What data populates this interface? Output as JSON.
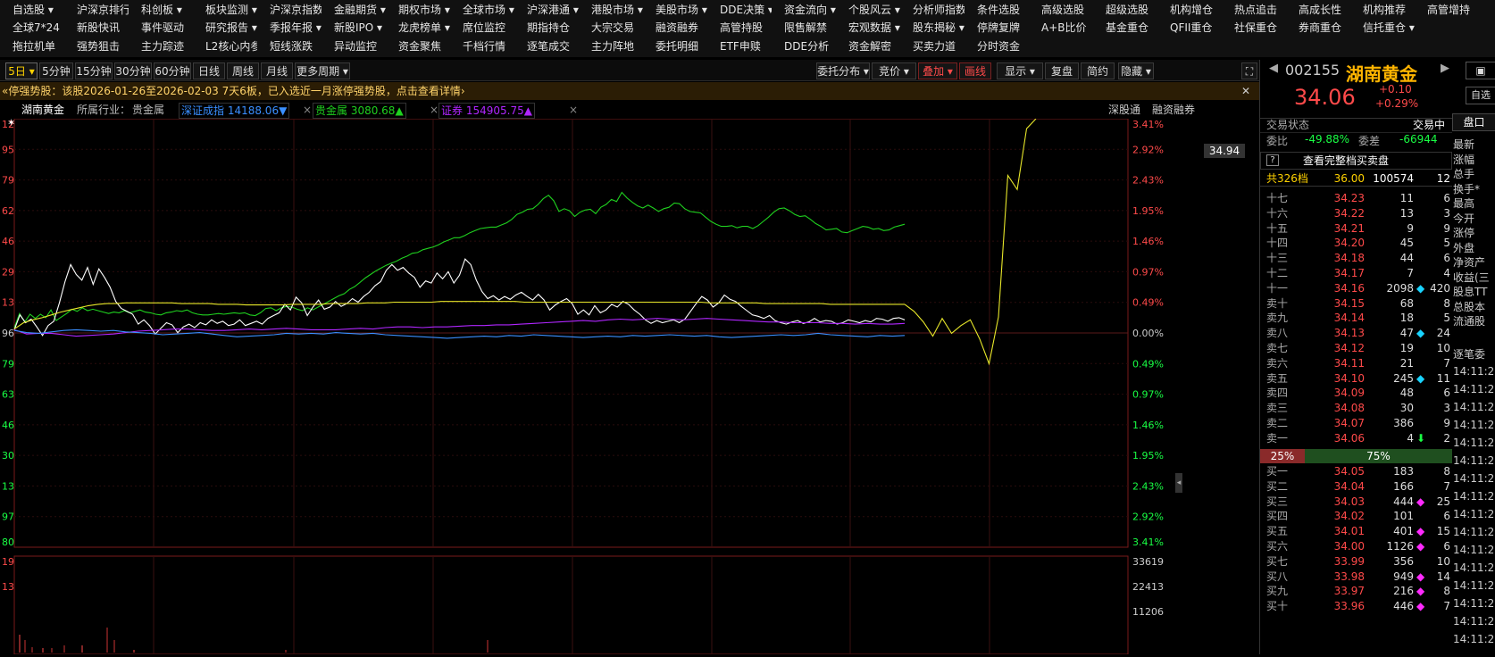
{
  "menu_row1": [
    "自选股 ▾",
    "沪深京排行 ▾",
    "科创板 ▾",
    "板块监测 ▾",
    "沪深京指数 ▾",
    "金融期货 ▾",
    "期权市场 ▾",
    "全球市场 ▾",
    "沪深港通 ▾",
    "港股市场 ▾",
    "美股市场 ▾",
    "DDE决策 ▾",
    "资金流向 ▾",
    "个股风云 ▾",
    "分析师指数",
    "条件选股",
    "高级选股",
    "超级选股",
    "机构增仓",
    "热点追击",
    "高成长性",
    "机构推荐",
    "高管增持"
  ],
  "menu_row2": [
    "全球7*24",
    "新股快讯",
    "事件驱动",
    "研究报告 ▾",
    "季报年报 ▾",
    "新股IPO ▾",
    "龙虎榜单 ▾",
    "席位监控",
    "期指持仓",
    "大宗交易",
    "融资融券",
    "高管持股",
    "限售解禁",
    "宏观数据 ▾",
    "股东揭秘 ▾",
    "停牌复牌",
    "A+B比价",
    "基金重仓",
    "QFII重仓",
    "社保重仓",
    "券商重仓",
    "信托重仓 ▾"
  ],
  "menu_row3": [
    "拖拉机单",
    "强势狙击",
    "主力踪迹",
    "L2核心内参",
    "短线涨跌",
    "异动监控",
    "资金聚焦",
    "千档行情",
    "逐笔成交",
    "主力阵地",
    "委托明细",
    "ETF申赎",
    "DDE分析",
    "资金解密",
    "买卖力道",
    "分时资金"
  ],
  "periods": [
    "5日 ▾",
    "5分钟",
    "15分钟",
    "30分钟",
    "60分钟",
    "日线",
    "周线",
    "月线",
    "更多周期 ▾"
  ],
  "tools": [
    "委托分布 ▾",
    "竞价 ▾",
    "叠加 ▾",
    "画线",
    "显示 ▾",
    "复盘",
    "简约",
    "隐藏 ▾"
  ],
  "notice": "«停强势股：该股2026-01-26至2026-02-03 7天6板，已入选近一月涨停强势股，点击查看详情›",
  "legend": {
    "stock": "湖南黄金",
    "industry_label": "所属行业：",
    "industry": "贵金属",
    "index1": "深证成指 14188.06▼",
    "index2": "贵金属 3080.68▲",
    "index3": "证券 154905.75▲",
    "link1": "深股通",
    "link2": "融资融券"
  },
  "price_tag": "34.94",
  "y_left": [
    "12",
    "95",
    "79",
    "62",
    "46",
    "29",
    "13",
    "96",
    "79",
    "63",
    "46",
    "30",
    "13",
    "97",
    "80"
  ],
  "y_right": [
    "3.41%",
    "2.92%",
    "2.43%",
    "1.95%",
    "1.46%",
    "0.97%",
    "0.49%",
    "0.00%",
    "0.49%",
    "0.97%",
    "1.46%",
    "1.95%",
    "2.43%",
    "2.92%",
    "3.41%"
  ],
  "vol_left": [
    "19",
    "13"
  ],
  "vol_right": [
    "33619",
    "22413",
    "11206"
  ],
  "colors": {
    "up": "#ff4a4a",
    "down": "#19d3ff",
    "green": "#1fd11f",
    "yellow": "#e8e82a",
    "white": "#ffffff",
    "purple": "#b026ff",
    "blue": "#3a8fff"
  },
  "chart_data": {
    "type": "line",
    "series": [
      {
        "name": "贵金属",
        "color": "#1fd11f",
        "values": [
          0.5,
          2.5,
          1.3,
          2.4,
          1.8,
          2.4,
          1.9,
          3.0,
          1.5,
          2.0,
          2.5,
          3.1,
          2.8,
          3.3,
          2.9,
          3.1,
          2.9,
          2.7,
          2.5,
          2.7,
          2.6,
          2.9,
          2.6,
          2.8,
          3.0,
          2.7,
          2.6,
          2.4,
          2.3,
          2.6,
          2.7,
          2.9,
          2.8,
          3.0,
          2.6,
          2.4,
          2.3,
          2.3,
          2.4,
          2.5,
          2.4,
          2.5,
          2.6,
          2.5,
          2.6,
          2.3,
          2.2,
          2.6,
          3.2,
          3.3,
          2.9,
          3.3,
          3.5,
          3.4,
          3.1,
          2.9,
          3.3,
          3.0,
          3.4,
          3.8,
          4.2,
          4.6,
          5.0,
          5.3,
          5.9,
          6.3,
          6.9,
          7.5,
          8.0,
          8.5,
          8.9,
          9.3,
          9.6,
          9.9,
          10.3,
          10.6,
          11.0,
          11.1,
          11.5,
          11.7,
          11.9,
          12.2,
          12.6,
          12.9,
          13.2,
          13.2,
          13.5,
          13.9,
          14.2,
          14.5,
          14.6,
          14.7,
          14.7,
          15.0,
          15.3,
          15.8,
          16.5,
          16.8,
          17.2,
          17.3,
          17.9,
          18.7,
          19.2,
          18.4,
          16.9,
          17.3,
          17.0,
          16.2,
          16.8,
          17.1,
          17.2,
          16.6,
          17.5,
          17.9,
          18.6,
          18.3,
          19.6,
          18.8,
          18.2,
          17.7,
          17.4,
          17.8,
          17.4,
          16.9,
          17.3,
          17.5,
          18.1,
          18.0,
          17.3,
          16.9,
          16.8,
          16.7,
          16.1,
          15.5,
          15.1,
          14.8,
          14.8,
          14.9,
          14.6,
          14.8,
          14.8,
          14.5,
          14.9,
          15.5,
          16.1,
          16.8,
          17.3,
          17.4,
          17.0,
          16.5,
          16.2,
          16.3,
          15.8,
          15.2,
          14.8,
          14.3,
          14.4,
          14.5,
          14.0,
          13.9,
          14.2,
          14.5,
          14.8,
          14.7,
          14.4,
          14.5,
          14.2,
          14.3,
          14.7,
          14.9,
          15.1
        ]
      },
      {
        "name": "湖南黄金",
        "color": "#ffffff",
        "values": [
          0.2,
          2.3,
          1.2,
          1.7,
          0.6,
          -0.6,
          0.8,
          1.4,
          4.0,
          7.0,
          9.4,
          8.0,
          7.2,
          9.0,
          6.6,
          8.8,
          7.6,
          6.2,
          4.2,
          3.2,
          2.8,
          2.4,
          1.0,
          1.6,
          0.8,
          -0.4,
          0.4,
          1.2,
          0.9,
          -0.2,
          0.6,
          1.0,
          0.5,
          1.2,
          0.9,
          1.6,
          1.1,
          1.4,
          0.8,
          1.0,
          1.6,
          0.8,
          1.1,
          1.4,
          1.0,
          1.8,
          2.2,
          2.6,
          3.8,
          3.0,
          4.8,
          4.0,
          2.2,
          3.4,
          4.4,
          3.1,
          3.4,
          4.2,
          3.5,
          3.9,
          4.6,
          4.1,
          4.9,
          5.5,
          6.4,
          7.0,
          8.6,
          9.4,
          8.6,
          9.0,
          8.2,
          7.6,
          6.2,
          7.1,
          6.8,
          8.2,
          7.4,
          8.4,
          6.8,
          7.9,
          10.2,
          9.4,
          7.2,
          5.6,
          4.6,
          5.0,
          4.4,
          4.9,
          4.5,
          5.1,
          5.5,
          4.9,
          4.4,
          5.2,
          4.4,
          3.0,
          3.7,
          4.2,
          4.6,
          3.9,
          2.4,
          3.0,
          2.3,
          3.6,
          2.6,
          3.0,
          3.8,
          3.4,
          4.2,
          3.8,
          3.0,
          2.4,
          1.6,
          1.1,
          1.5,
          1.2,
          1.4,
          1.6,
          1.2,
          1.7,
          2.8,
          3.9,
          4.9,
          4.4,
          3.4,
          4.0,
          5.1,
          4.5,
          4.2,
          3.5,
          2.9,
          2.3,
          2.1,
          1.8,
          2.2,
          1.5,
          1.2,
          1.0,
          1.3,
          1.5,
          1.1,
          1.3,
          1.8,
          1.3,
          1.5,
          1.4,
          1.0,
          1.2,
          1.6,
          1.4,
          1.2,
          1.5,
          1.3,
          1.8,
          1.7,
          1.4,
          1.8,
          1.9,
          1.6
        ]
      },
      {
        "name": "均价",
        "color": "#e8e82a",
        "values": [
          0.3,
          1.2,
          1.6,
          1.9,
          2.3,
          2.7,
          3.0,
          3.3,
          3.6,
          3.8,
          3.9,
          3.9,
          4.0,
          4.0,
          4.0,
          4.0,
          4.0,
          4.0,
          3.9,
          3.9,
          3.9,
          3.9,
          3.8,
          3.8,
          3.8,
          3.7,
          3.7,
          3.7,
          3.7,
          3.7,
          3.8,
          3.8,
          3.8,
          3.8,
          3.9,
          3.9,
          3.9,
          3.9,
          4.0,
          4.0,
          4.0,
          4.1,
          4.1,
          4.1,
          4.1,
          4.1,
          4.2,
          4.2,
          4.2,
          4.2,
          4.2,
          4.2,
          4.2,
          4.2,
          4.2,
          4.1,
          4.1,
          4.1,
          4.1,
          4.1,
          4.1,
          4.1,
          4.1,
          4.1,
          4.1,
          4.1,
          4.1,
          4.1,
          4.1,
          4.1,
          4.1,
          4.1,
          4.1,
          4.1,
          4.1,
          4.0,
          4.0,
          4.0,
          4.0,
          4.0,
          4.0,
          3.9,
          3.9,
          3.9,
          3.9,
          3.9,
          3.9,
          3.9,
          3.8,
          3.8,
          3.8,
          3.8,
          3.8,
          3.8,
          3.8,
          3.8,
          3.8
        ]
      },
      {
        "name": "证券",
        "color": "#b026ff",
        "values": [
          0.2,
          -0.4,
          -0.3,
          -0.3,
          -0.5,
          -0.7,
          -0.6,
          -0.5,
          -0.4,
          -0.2,
          0.0,
          0.1,
          0.2,
          0.3,
          0.3,
          0.2,
          0.1,
          0.1,
          0.2,
          0.3,
          0.2,
          0.3,
          0.4,
          0.3,
          0.2,
          0.2,
          0.2,
          0.3,
          0.4,
          0.3,
          0.5,
          0.6,
          0.6,
          0.5,
          0.6,
          0.6,
          0.7,
          0.8,
          0.8,
          0.9,
          0.9,
          1.0,
          1.1,
          1.2,
          1.3,
          1.4,
          1.5,
          1.4,
          1.6,
          1.7,
          1.6,
          1.7,
          1.8,
          1.7,
          1.6,
          1.7,
          1.8,
          1.7,
          1.6,
          1.5,
          1.4,
          1.3,
          1.3,
          1.2,
          1.2,
          1.2,
          1.1,
          1.1,
          1.0,
          1.1,
          1.0,
          1.0,
          1.1
        ]
      },
      {
        "name": "深证成指",
        "color": "#3a8fff",
        "values": [
          0.1,
          -0.2,
          -0.3,
          -0.1,
          0.1,
          0.2,
          0.1,
          0.0,
          0.1,
          -0.1,
          -0.2,
          -0.3,
          -0.5,
          -0.4,
          -0.3,
          -0.2,
          -0.4,
          -0.6,
          -0.8,
          -0.7,
          -0.6,
          -0.5,
          -0.3,
          -0.4,
          -0.3,
          -0.4,
          -0.2,
          -0.3,
          -0.4,
          -0.3,
          -0.5,
          -0.6,
          -0.7,
          -0.8,
          -0.9,
          -1.0,
          -0.9,
          -0.8,
          -0.7,
          -0.8,
          -0.6,
          -0.7,
          -0.5,
          -0.6,
          -0.7,
          -0.8,
          -0.9,
          -0.8,
          -0.7,
          -0.8,
          -0.6,
          -0.7,
          -0.6,
          -0.5,
          -0.6,
          -0.7,
          -0.6,
          -0.8,
          -0.9,
          -0.8,
          -0.7,
          -0.6,
          -0.5,
          -0.6,
          -0.5,
          -0.3,
          -0.5,
          -0.6,
          -0.7,
          -0.8,
          -0.6,
          -0.7,
          -0.6
        ]
      },
      {
        "name": "今日",
        "color": "#e8e82a",
        "values": [
          3.8,
          2.8,
          1.3,
          -0.7,
          1.8,
          -0.3,
          0.8,
          1.6,
          -1.1,
          -4.6,
          2.0,
          22.0,
          20.0,
          28.6,
          30.0
        ]
      }
    ]
  },
  "quote": {
    "code": "002155",
    "name": "湖南黄金",
    "price": "34.06",
    "change": "+0.10",
    "pct": "+0.29%",
    "status_label": "交易状态",
    "status": "交易中",
    "wb_label": "委比",
    "wb": "-49.88%",
    "wc_label": "委差",
    "wc": "-66944",
    "full_book": "查看完整档买卖盘",
    "total_levels": "共326档",
    "total_price": "36.00",
    "total_vol": "100574",
    "total_cnt": "12",
    "pct_bar_left": "25%",
    "pct_bar_right": "75%",
    "side_tabs": [
      "盘口"
    ],
    "side_labels": [
      "最新",
      "涨幅",
      "总手",
      "换手*",
      "最高",
      "今开",
      "涨停",
      "外盘",
      "净资产",
      "收益(三",
      "股息TT",
      "总股本",
      "流通股"
    ],
    "trades_label": "逐笔委",
    "trade_times": [
      "14:11:2",
      "14:11:2",
      "14:11:2",
      "14:11:2",
      "14:11:2",
      "14:11:2",
      "14:11:2",
      "14:11:2",
      "14:11:2",
      "14:11:2",
      "14:11:2",
      "14:11:2",
      "14:11:2",
      "14:11:2",
      "14:11:2",
      "14:11:2"
    ]
  },
  "sell_orders": [
    {
      "n": "十七",
      "p": "34.23",
      "v": "11",
      "c": "6",
      "d": ""
    },
    {
      "n": "十六",
      "p": "34.22",
      "v": "13",
      "c": "3",
      "d": ""
    },
    {
      "n": "十五",
      "p": "34.21",
      "v": "9",
      "c": "9",
      "d": ""
    },
    {
      "n": "十四",
      "p": "34.20",
      "v": "45",
      "c": "5",
      "d": ""
    },
    {
      "n": "十三",
      "p": "34.18",
      "v": "44",
      "c": "6",
      "d": ""
    },
    {
      "n": "十二",
      "p": "34.17",
      "v": "7",
      "c": "4",
      "d": ""
    },
    {
      "n": "十一",
      "p": "34.16",
      "v": "2098",
      "c": "420",
      "d": "◆"
    },
    {
      "n": "卖十",
      "p": "34.15",
      "v": "68",
      "c": "8",
      "d": ""
    },
    {
      "n": "卖九",
      "p": "34.14",
      "v": "18",
      "c": "5",
      "d": ""
    },
    {
      "n": "卖八",
      "p": "34.13",
      "v": "47",
      "c": "24",
      "d": "◆"
    },
    {
      "n": "卖七",
      "p": "34.12",
      "v": "19",
      "c": "10",
      "d": ""
    },
    {
      "n": "卖六",
      "p": "34.11",
      "v": "21",
      "c": "7",
      "d": ""
    },
    {
      "n": "卖五",
      "p": "34.10",
      "v": "245",
      "c": "11",
      "d": "◆"
    },
    {
      "n": "卖四",
      "p": "34.09",
      "v": "48",
      "c": "6",
      "d": ""
    },
    {
      "n": "卖三",
      "p": "34.08",
      "v": "30",
      "c": "3",
      "d": ""
    },
    {
      "n": "卖二",
      "p": "34.07",
      "v": "386",
      "c": "9",
      "d": ""
    },
    {
      "n": "卖一",
      "p": "34.06",
      "v": "4",
      "c": "2",
      "d": "⬇"
    }
  ],
  "buy_orders": [
    {
      "n": "买一",
      "p": "34.05",
      "v": "183",
      "c": "8",
      "d": ""
    },
    {
      "n": "买二",
      "p": "34.04",
      "v": "166",
      "c": "7",
      "d": ""
    },
    {
      "n": "买三",
      "p": "34.03",
      "v": "444",
      "c": "25",
      "d": "◆"
    },
    {
      "n": "买四",
      "p": "34.02",
      "v": "101",
      "c": "6",
      "d": ""
    },
    {
      "n": "买五",
      "p": "34.01",
      "v": "401",
      "c": "15",
      "d": "◆"
    },
    {
      "n": "买六",
      "p": "34.00",
      "v": "1126",
      "c": "6",
      "d": "◆"
    },
    {
      "n": "买七",
      "p": "33.99",
      "v": "356",
      "c": "10",
      "d": ""
    },
    {
      "n": "买八",
      "p": "33.98",
      "v": "949",
      "c": "14",
      "d": "◆"
    },
    {
      "n": "买九",
      "p": "33.97",
      "v": "216",
      "c": "8",
      "d": "◆"
    },
    {
      "n": "买十",
      "p": "33.96",
      "v": "446",
      "c": "7",
      "d": "◆"
    }
  ]
}
